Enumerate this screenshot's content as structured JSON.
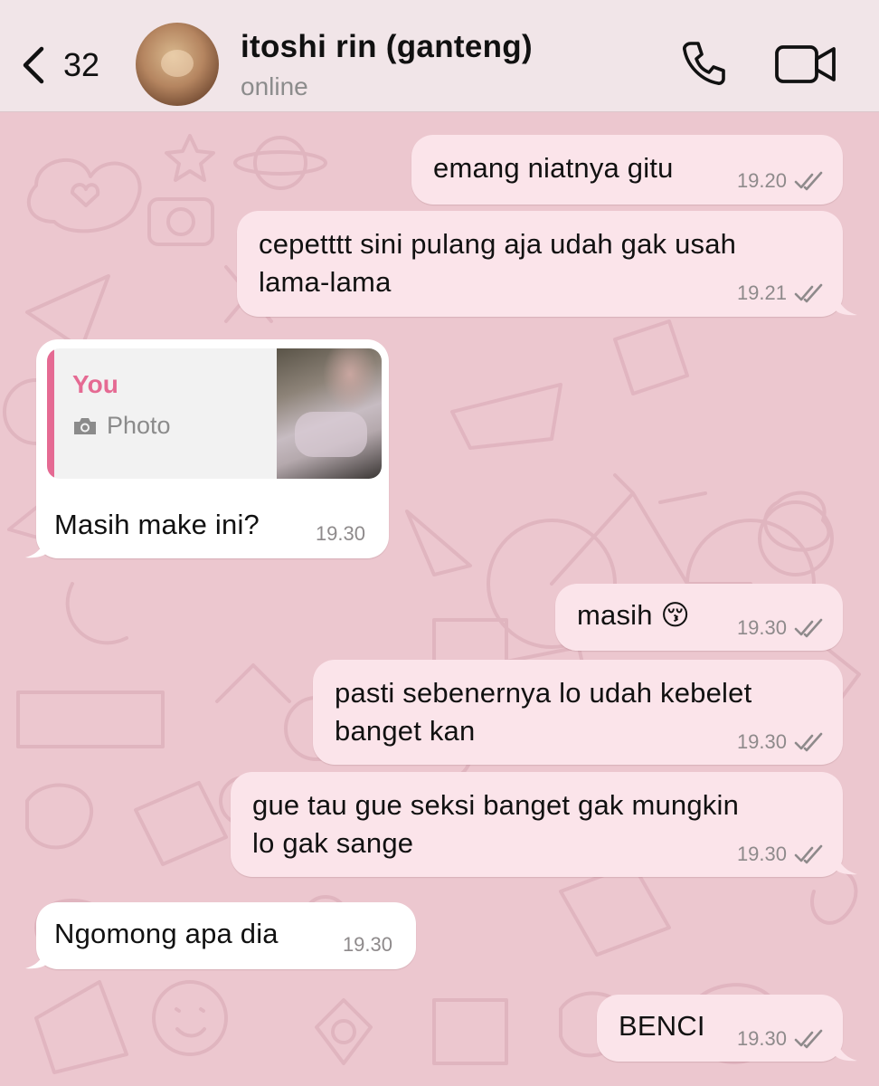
{
  "header": {
    "back_count": "32",
    "contact_name": "itoshi rin (ganteng)",
    "contact_status": "online"
  },
  "messages": [
    {
      "direction": "out",
      "text_lines": [
        "emang niatnya gitu"
      ],
      "time": "19.20",
      "read": true
    },
    {
      "direction": "out",
      "text_lines": [
        "cepetttt sini pulang aja udah gak usah",
        "lama-lama"
      ],
      "time": "19.21",
      "read": true
    },
    {
      "direction": "in",
      "reply": {
        "author": "You",
        "kind": "Photo"
      },
      "text_lines": [
        "Masih make ini?"
      ],
      "time": "19.30"
    },
    {
      "direction": "out",
      "text_lines": [
        "masih 😚"
      ],
      "time": "19.30",
      "read": true
    },
    {
      "direction": "out",
      "text_lines": [
        "pasti sebenernya lo udah kebelet",
        "banget kan"
      ],
      "time": "19.30",
      "read": true
    },
    {
      "direction": "out",
      "text_lines": [
        "gue tau gue seksi banget gak mungkin",
        "lo gak sange"
      ],
      "time": "19.30",
      "read": true
    },
    {
      "direction": "in",
      "text_lines": [
        "Ngomong apa dia"
      ],
      "time": "19.30"
    },
    {
      "direction": "out",
      "text_lines": [
        "BENCI"
      ],
      "time": "19.30",
      "read": true
    }
  ],
  "colors": {
    "header_bg": "#f1e5e8",
    "wallpaper": "#ecc7cf",
    "outgoing_bubble": "#fbe4ea",
    "incoming_bubble": "#ffffff",
    "reply_accent": "#e56a93",
    "read_ticks": "#8e8a8b"
  },
  "icons": [
    "back-chevron-icon",
    "phone-icon",
    "video-call-icon",
    "camera-icon",
    "double-check-icon"
  ]
}
